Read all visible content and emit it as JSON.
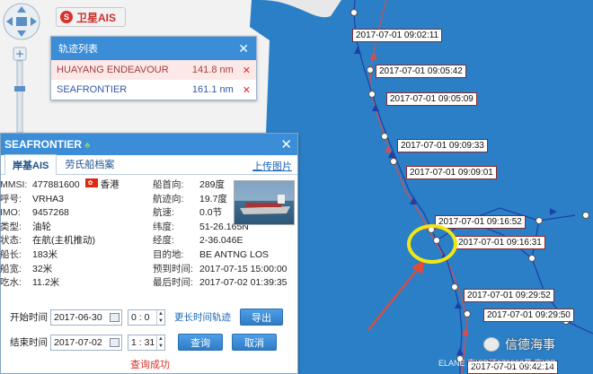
{
  "toolbar": {
    "satellite_label": "卫星AIS"
  },
  "track_list": {
    "title": "轨迹列表",
    "items": [
      {
        "name": "HUAYANG ENDEAVOUR",
        "distance": "141.8 nm"
      },
      {
        "name": "SEAFRONTIER",
        "distance": "161.1 nm"
      }
    ]
  },
  "ship_panel": {
    "name": "SEAFRONTIER",
    "tabs": [
      "岸基AIS",
      "劳氏船档案"
    ],
    "upload_photo": "上传图片",
    "info_left": [
      {
        "key": "MMSI:",
        "value": "477881600",
        "extra": "香港"
      },
      {
        "key": "呼号:",
        "value": "VRHA3"
      },
      {
        "key": "IMO:",
        "value": "9457268"
      },
      {
        "key": "类型:",
        "value": "油轮"
      },
      {
        "key": "状态:",
        "value": "在航(主机推动)"
      },
      {
        "key": "船长:",
        "value": "183米"
      },
      {
        "key": "船宽:",
        "value": "32米"
      },
      {
        "key": "吃水:",
        "value": "11.2米"
      }
    ],
    "info_right": [
      {
        "key": "船首向:",
        "value": "289度"
      },
      {
        "key": "航迹向:",
        "value": "19.7度"
      },
      {
        "key": "航速:",
        "value": "0.0节"
      },
      {
        "key": "纬度:",
        "value": "51-26.165N"
      },
      {
        "key": "经度:",
        "value": "2-36.046E"
      },
      {
        "key": "目的地:",
        "value": "BE ANTNG LOS"
      },
      {
        "key": "预到时间:",
        "value": "2017-07-15 15:00:00"
      },
      {
        "key": "最后时间:",
        "value": "2017-07-02 01:39:35"
      }
    ],
    "start_label": "开始时间",
    "start_date": "2017-06-30",
    "start_time": "0 : 0",
    "more_tracks": "更长时间轨迹",
    "export_label": "导出",
    "end_label": "结束时间",
    "end_date": "2017-07-02",
    "end_time": "1 : 31",
    "query_label": "查询",
    "cancel_label": "取消",
    "status": "查询成功"
  },
  "map_labels": [
    "2017-07-01 09:02:11",
    "2017-07-01 09:05:42",
    "2017-07-01 09:05:09",
    "2017-07-01 09:09:33",
    "2017-07-01 09:09:01",
    "2017-07-01 09:16:52",
    "2017-07-01 09:16:31",
    "2017-07-01 09:29:52",
    "2017-07-01 09:29:50",
    "2017-07-01 09:42:14"
  ],
  "watermark": "信德海事",
  "footer_text": "ELANE 京ICP证070006号 京ICP",
  "colors": {
    "sea": "#2a7fc6",
    "header": "#3a8dd6",
    "track_red": "#d25050",
    "track_blue": "#1e3fa8",
    "highlight": "#f0e614"
  }
}
